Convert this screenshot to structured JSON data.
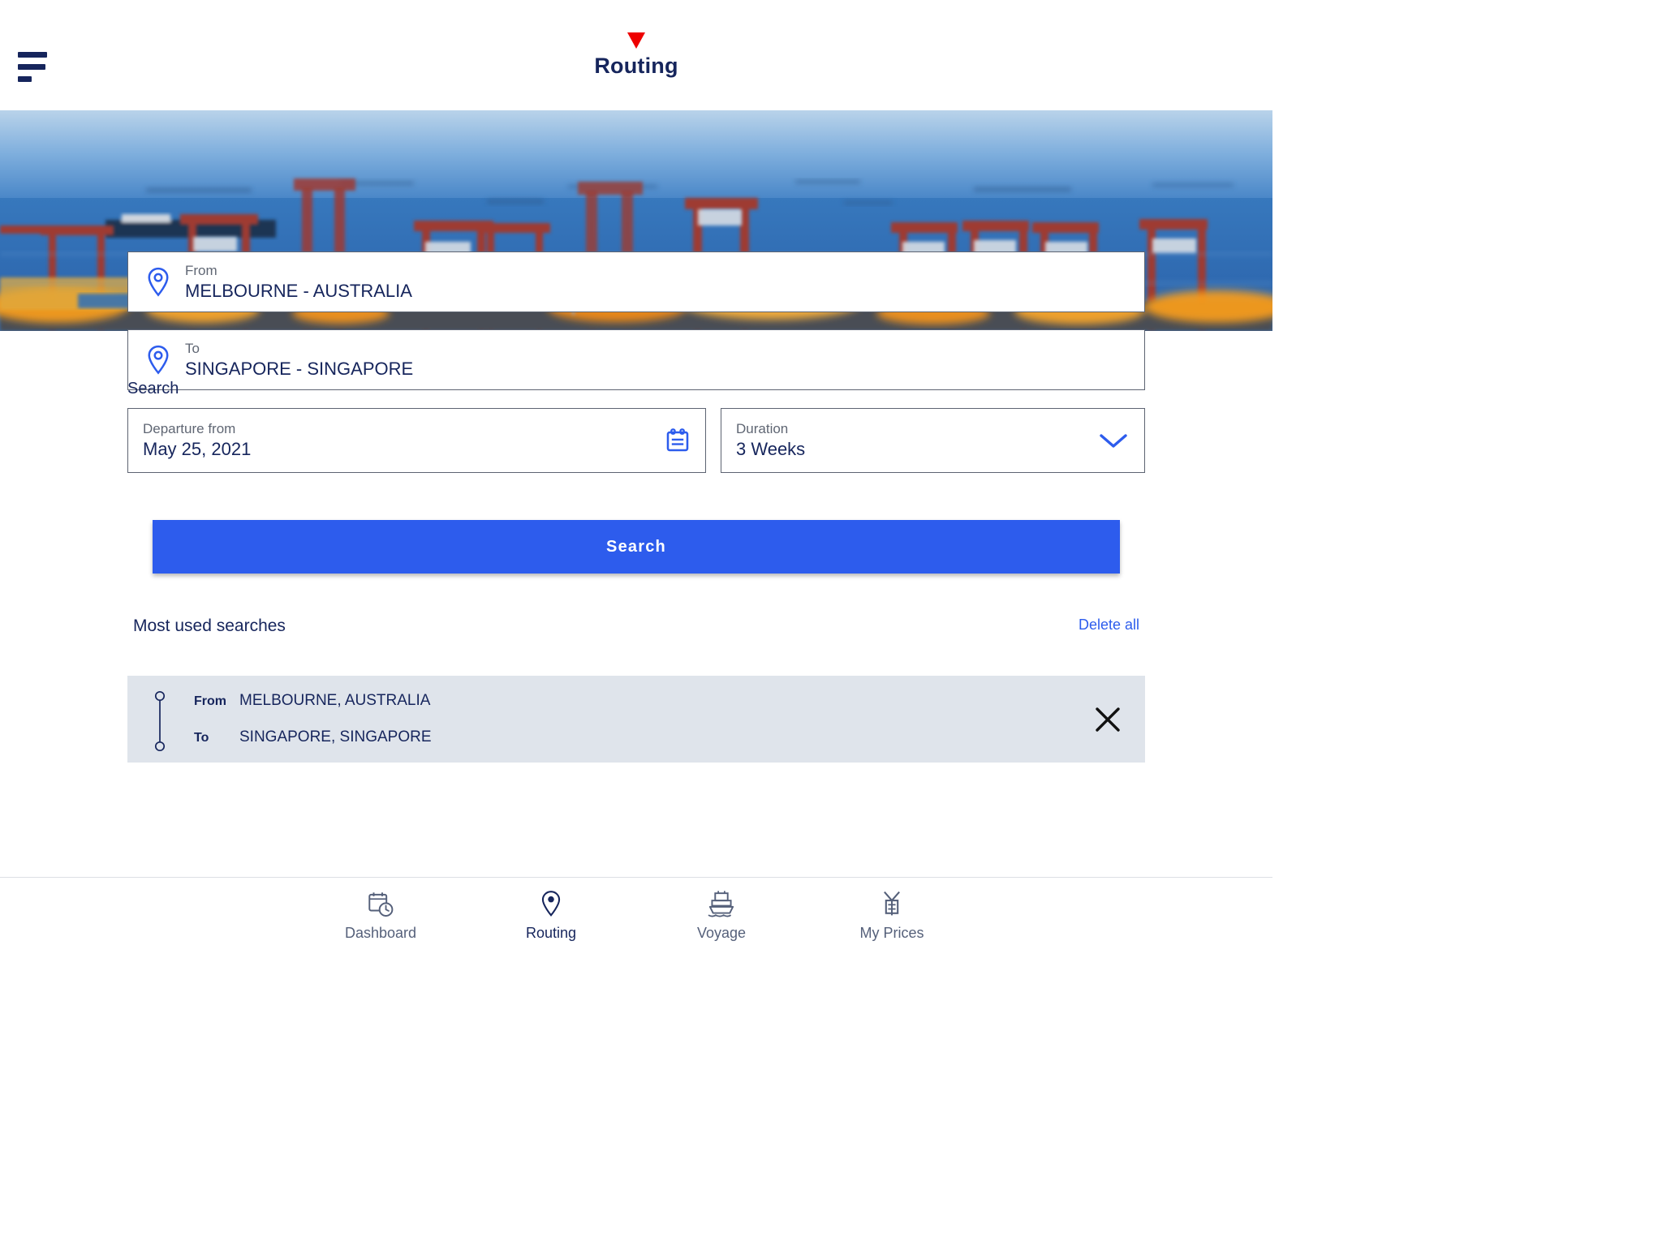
{
  "header": {
    "menu_icon": "hamburger-menu-icon",
    "marker_icon": "red-triangle-marker",
    "title": "Routing"
  },
  "hero": {
    "image_alt": "container port with cranes at dusk",
    "sky_color": "#8fb8e0",
    "water_color": "#2f6fb8",
    "crane_color": "#9e3b31"
  },
  "form": {
    "from": {
      "icon": "location-pin-icon",
      "label": "From",
      "value": "MELBOURNE - AUSTRALIA"
    },
    "to": {
      "icon": "location-pin-icon",
      "label": "To",
      "value": "SINGAPORE - SINGAPORE"
    },
    "section_label": "Search",
    "departure": {
      "label": "Departure from",
      "value": "May 25, 2021",
      "icon": "calendar-icon"
    },
    "duration": {
      "label": "Duration",
      "value": "3 Weeks",
      "icon": "chevron-down-icon"
    },
    "search_button": "Search",
    "accent_color": "#2d5ced"
  },
  "most_used": {
    "title": "Most used searches",
    "delete_all": "Delete all",
    "items": [
      {
        "from_key": "From",
        "from_value": "MELBOURNE, AUSTRALIA",
        "to_key": "To",
        "to_value": "SINGAPORE, SINGAPORE",
        "remove_icon": "close-x-icon"
      }
    ]
  },
  "bottom_nav": {
    "items": [
      {
        "label": "Dashboard",
        "icon": "dashboard-calendar-clock-icon",
        "active": false
      },
      {
        "label": "Routing",
        "icon": "location-pin-icon",
        "active": true
      },
      {
        "label": "Voyage",
        "icon": "ship-icon",
        "active": false
      },
      {
        "label": "My Prices",
        "icon": "price-tag-icon",
        "active": false
      }
    ]
  }
}
